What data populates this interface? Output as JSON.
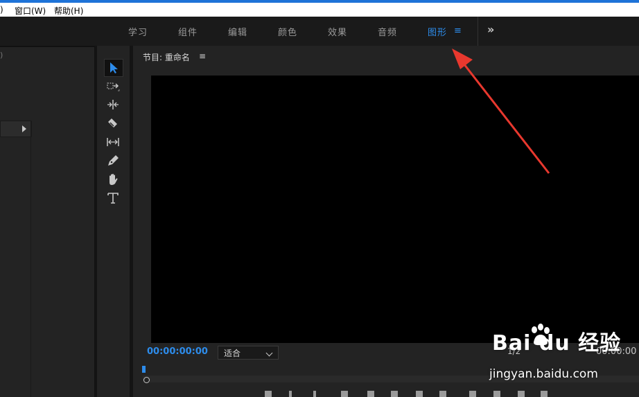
{
  "menu": {
    "item_partial": ")",
    "window": "窗口(W)",
    "help": "帮助(H)"
  },
  "workspaces": {
    "tabs": [
      "学习",
      "组件",
      "编辑",
      "颜色",
      "效果",
      "音频",
      "图形"
    ],
    "active": "图形",
    "menu_icon": "≡",
    "overflow": "»"
  },
  "left_panel": {
    "partial": ")"
  },
  "tools": [
    "selection-icon",
    "track-select-forward-icon",
    "ripple-edit-icon",
    "razor-icon",
    "slip-icon",
    "pen-icon",
    "hand-icon",
    "type-icon"
  ],
  "program": {
    "title": "节目: 重命名",
    "title_menu": "≡",
    "timecode": "00:00:00:00",
    "fit": "适合",
    "ratio": "1/2",
    "end_timecode": "00:00:00"
  },
  "watermark": {
    "logo": "Bai du 经验",
    "url": "jingyan.baidu.com"
  },
  "colors": {
    "accent": "#2d8ceb",
    "annotation": "#e8382e"
  }
}
